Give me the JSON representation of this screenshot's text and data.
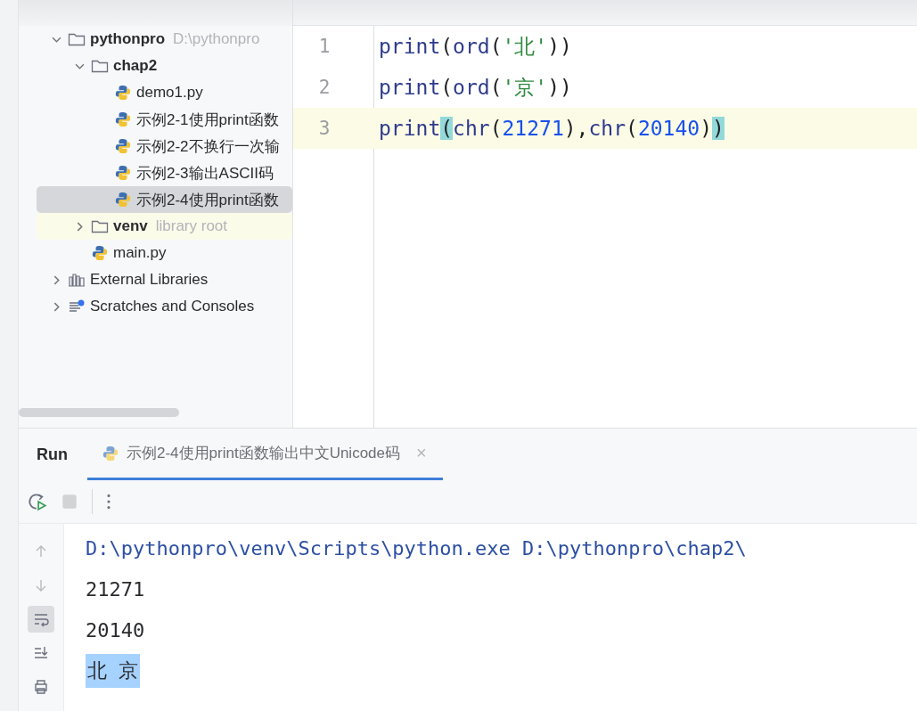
{
  "project_tree": [
    {
      "label": "pythonpro",
      "hint": "D:\\pythonpro",
      "kind": "folder",
      "expanded": true,
      "selected": false,
      "children": [
        {
          "label": "chap2",
          "kind": "folder",
          "expanded": true,
          "selected": false,
          "children": [
            {
              "label": "demo1.py",
              "kind": "python",
              "selected": false
            },
            {
              "label": "示例2-1使用print函数",
              "kind": "python",
              "selected": false
            },
            {
              "label": "示例2-2不换行一次输",
              "kind": "python",
              "selected": false
            },
            {
              "label": "示例2-3输出ASCII码",
              "kind": "python",
              "selected": false
            },
            {
              "label": "示例2-4使用print函数",
              "kind": "python",
              "selected": true
            }
          ]
        },
        {
          "label": "venv",
          "hint": "library root",
          "kind": "library-folder",
          "expanded": false,
          "selected": false
        },
        {
          "label": "main.py",
          "kind": "python",
          "selected": false
        }
      ]
    },
    {
      "label": "External Libraries",
      "kind": "library",
      "expanded": false,
      "selected": false
    },
    {
      "label": "Scratches and Consoles",
      "kind": "scratches",
      "expanded": false,
      "selected": false
    }
  ],
  "editor": {
    "lines": [
      {
        "number": "1",
        "current": false,
        "tokens": [
          {
            "text": "print",
            "kind": "builtin"
          },
          {
            "text": "(",
            "kind": "plain"
          },
          {
            "text": "ord",
            "kind": "builtin"
          },
          {
            "text": "(",
            "kind": "plain"
          },
          {
            "text": "'北'",
            "kind": "string"
          },
          {
            "text": "))",
            "kind": "plain"
          }
        ]
      },
      {
        "number": "2",
        "current": false,
        "tokens": [
          {
            "text": "print",
            "kind": "builtin"
          },
          {
            "text": "(",
            "kind": "plain"
          },
          {
            "text": "ord",
            "kind": "builtin"
          },
          {
            "text": "(",
            "kind": "plain"
          },
          {
            "text": "'京'",
            "kind": "string"
          },
          {
            "text": "))",
            "kind": "plain"
          }
        ]
      },
      {
        "number": "3",
        "current": true,
        "tokens": [
          {
            "text": "print",
            "kind": "builtin"
          },
          {
            "text": "(",
            "kind": "brace-match"
          },
          {
            "text": "chr",
            "kind": "builtin"
          },
          {
            "text": "(",
            "kind": "plain"
          },
          {
            "text": "21271",
            "kind": "number"
          },
          {
            "text": "),",
            "kind": "plain"
          },
          {
            "text": "chr",
            "kind": "builtin"
          },
          {
            "text": "(",
            "kind": "plain"
          },
          {
            "text": "20140",
            "kind": "number"
          },
          {
            "text": ")",
            "kind": "plain"
          },
          {
            "text": ")",
            "kind": "brace-match"
          }
        ]
      }
    ]
  },
  "run_panel": {
    "title": "Run",
    "tabs": [
      {
        "label": "示例2-4使用print函数输出中文Unicode码",
        "selected": true,
        "close": "×"
      }
    ],
    "toolbar": [
      {
        "kind": "rerun",
        "disabled": false
      },
      {
        "kind": "stop",
        "disabled": true
      },
      {
        "kind": "more",
        "disabled": false
      }
    ],
    "gutter": [
      {
        "kind": "up",
        "selected": false
      },
      {
        "kind": "down",
        "selected": false
      },
      {
        "kind": "wrap",
        "selected": true
      },
      {
        "kind": "scroll-end",
        "selected": false
      },
      {
        "kind": "print",
        "selected": false
      }
    ],
    "console": [
      {
        "text": "D:\\pythonpro\\venv\\Scripts\\python.exe D:\\pythonpro\\chap2\\",
        "kind": "command",
        "selected": false
      },
      {
        "text": "21271",
        "kind": "output",
        "selected": false
      },
      {
        "text": "20140",
        "kind": "output",
        "selected": false
      },
      {
        "text": "北 京",
        "kind": "output",
        "selected": true
      }
    ]
  }
}
